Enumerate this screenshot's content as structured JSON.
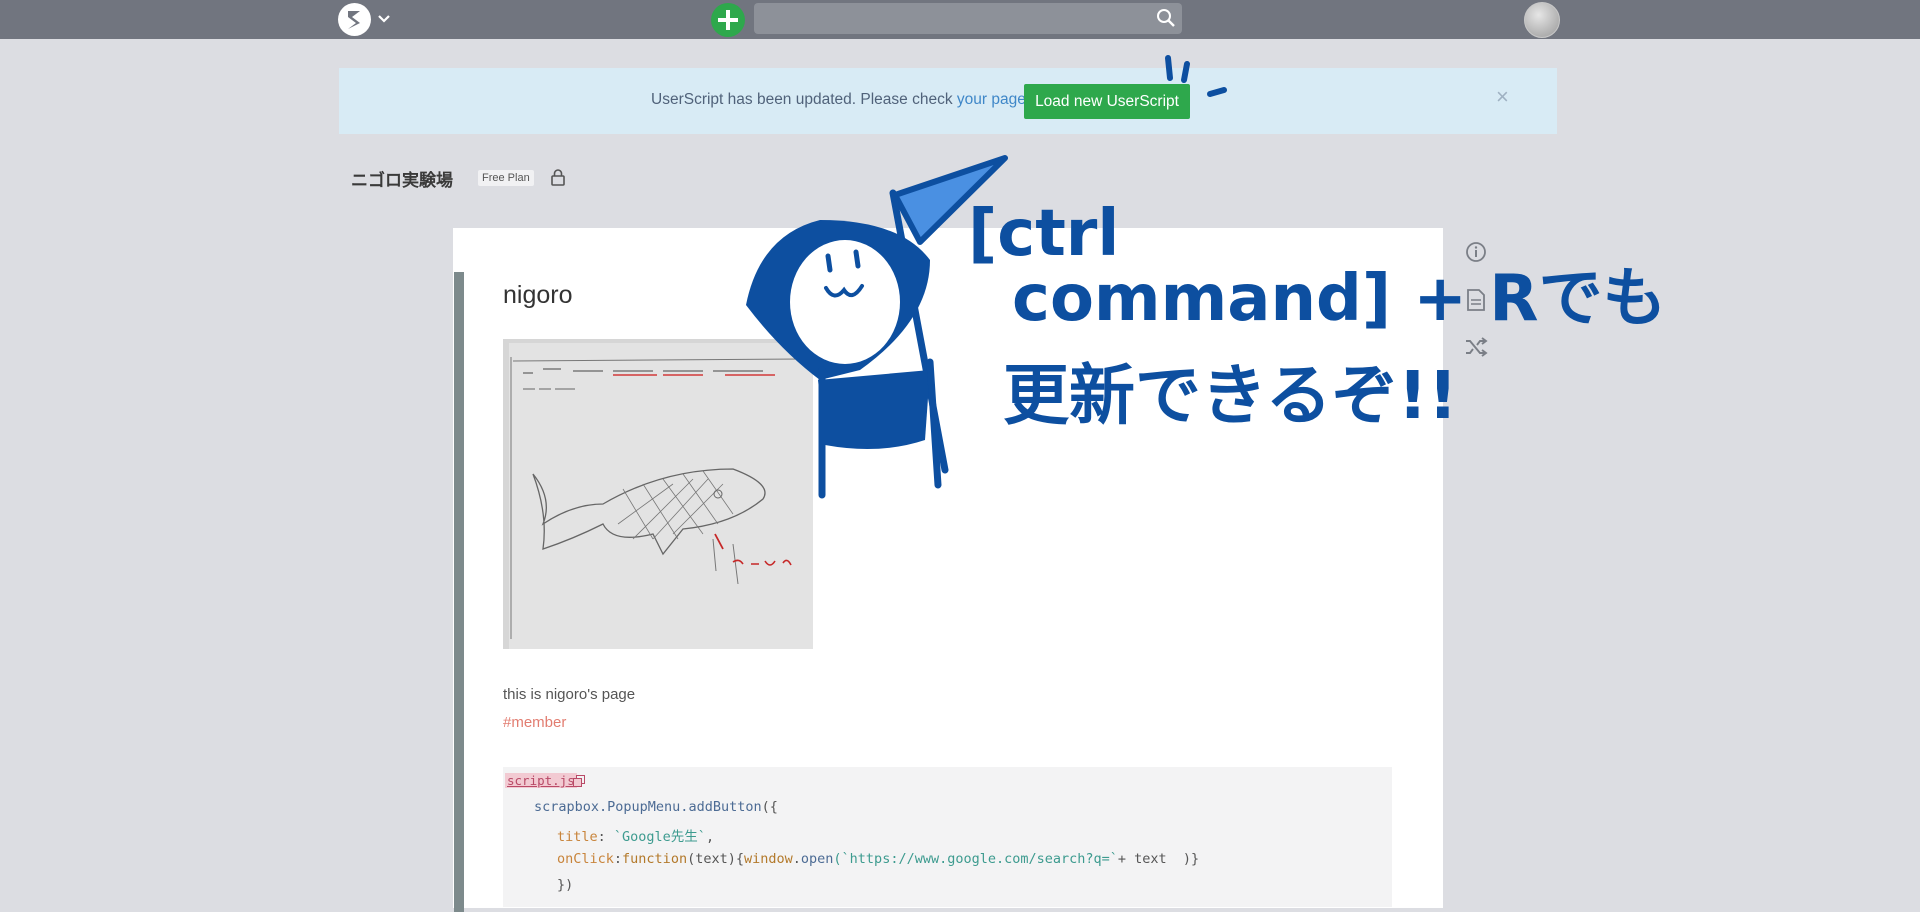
{
  "notice": {
    "text": "UserScript has been updated. Please check",
    "link": "your page",
    "suffix": ".",
    "button": "Load new UserScript",
    "close": "×"
  },
  "project": {
    "title": "ニゴロ実験場",
    "plan": "Free Plan"
  },
  "page": {
    "title": "nigoro",
    "description": "this is nigoro's page",
    "hashtag": "#member"
  },
  "code": {
    "filename": "script.js",
    "line1": {
      "ident": "scrapbox.PopupMenu.",
      "call": "addButton",
      "tail": "({"
    },
    "line2": {
      "key": "title",
      "sep": ": ",
      "str": "`Google先生`",
      "tail": ","
    },
    "line3": {
      "key": "onClick",
      "sep": ":",
      "fn": "function",
      "args": "(text){",
      "win": "window",
      "dot": ".",
      "open": "open",
      "str": "(`https://www.google.com/search?q=`",
      "tail": "+ text  )}"
    },
    "line4": "})"
  },
  "annotation": {
    "line1": "[ctrl",
    "line2": "command] + Rでも",
    "line3": "更新できるぞ!!",
    "color": "#0d4fa0"
  },
  "colors": {
    "navbar": "#71757f",
    "accent_green": "#2ea84c",
    "notice_bg": "#d8ebf5",
    "hashtag": "#e27d71"
  }
}
